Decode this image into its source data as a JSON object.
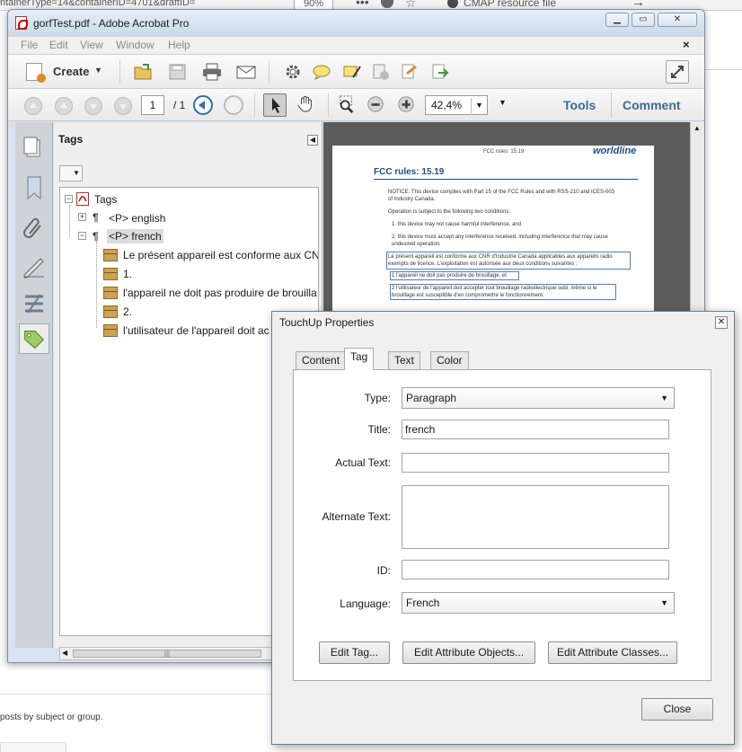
{
  "browser": {
    "url_fragment": "ntainerType=14&containerID=4701&draftID=",
    "zoom": "90%",
    "bookmark": "CMAP resource file",
    "footer_text": "posts by subject or group."
  },
  "acrobat": {
    "title": "gorfTest.pdf - Adobe Acrobat Pro",
    "menu": [
      "File",
      "Edit",
      "View",
      "Window",
      "Help"
    ],
    "create_label": "Create",
    "page_current": "1",
    "page_total": "/ 1",
    "zoom": "42,4%",
    "tools_label": "Tools",
    "comment_label": "Comment",
    "tags_panel": {
      "title": "Tags",
      "root": "Tags",
      "items": [
        {
          "label": "<P> english"
        },
        {
          "label": "<P> french"
        }
      ],
      "children": [
        "Le présent appareil est conforme aux CNR",
        "1.",
        "l'appareil ne doit pas produire de brouilla",
        "2.",
        "l'utilisateur de l'appareil doit ac"
      ]
    },
    "pdf": {
      "header_small": "FCC rules: 15.19",
      "logo": "worldline",
      "title": "FCC rules: 15.19",
      "lines": [
        "NOTICE: This device complies with Part 15 of the FCC Rules and with RSS-210 and ICES-003",
        "of Industry Canada.",
        "Operation is subject to the following two conditions:",
        "1.  this device may not cause harmful interference, and",
        "2.  this device must accept any interference received, including interference that may cause",
        "     undesired operation.",
        "Le présent appareil est conforme aux CNR d'Industrie Canada applicables aux appareils radio",
        "exempts de licence. L'exploitation est autorisée aux deux conditions suivantes :",
        "1   l'appareil ne doit pas produire de brouillage, et",
        "2   l'utilisateur de l'appareil doit accepter tout brouillage radioélectrique subi, même si le",
        "     brouillage est susceptible d'en compromettre le fonctionnement."
      ]
    }
  },
  "touchup": {
    "title": "TouchUp Properties",
    "tabs": [
      "Content",
      "Tag",
      "Text",
      "Color"
    ],
    "type_label": "Type:",
    "type_value": "Paragraph",
    "title_label": "Title:",
    "title_value": "french",
    "actual_text_label": "Actual Text:",
    "actual_text_value": "",
    "alternate_text_label": "Alternate Text:",
    "alternate_text_value": "",
    "id_label": "ID:",
    "id_value": "",
    "language_label": "Language:",
    "language_value": "French",
    "edit_tag": "Edit Tag...",
    "edit_attr_objects": "Edit Attribute Objects...",
    "edit_attr_classes": "Edit Attribute Classes...",
    "close": "Close"
  },
  "colors": {
    "accent_blue": "#3f6a97",
    "pdf_blue": "#1a4f8a"
  }
}
